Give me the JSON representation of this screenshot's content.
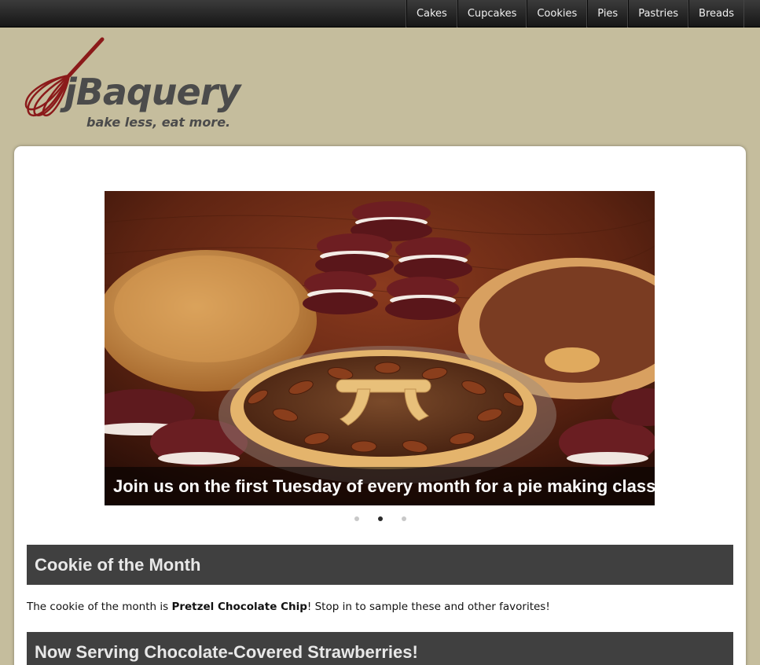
{
  "nav": {
    "items": [
      "Cakes",
      "Cupcakes",
      "Cookies",
      "Pies",
      "Pastries",
      "Breads"
    ]
  },
  "brand": {
    "name": "jBaquery",
    "tagline": "bake less, eat more.",
    "logo_color": "#8b1a1a",
    "text_color": "#4b4b4b"
  },
  "slider": {
    "caption": "Join us on the first Tuesday of every month for a pie making class!",
    "slide_count": 3,
    "active_index": 1
  },
  "sections": {
    "cookie_heading": "Cookie of the Month",
    "cookie_text_before": "The cookie of the month is ",
    "cookie_name": "Pretzel Chocolate Chip",
    "cookie_text_after": "! Stop in to sample these and other favorites!",
    "strawberries_heading": "Now Serving Chocolate-Covered Strawberries!"
  },
  "colors": {
    "background": "#c5bd9d",
    "section_header": "#404040",
    "topbar": "#1e1e1e"
  }
}
